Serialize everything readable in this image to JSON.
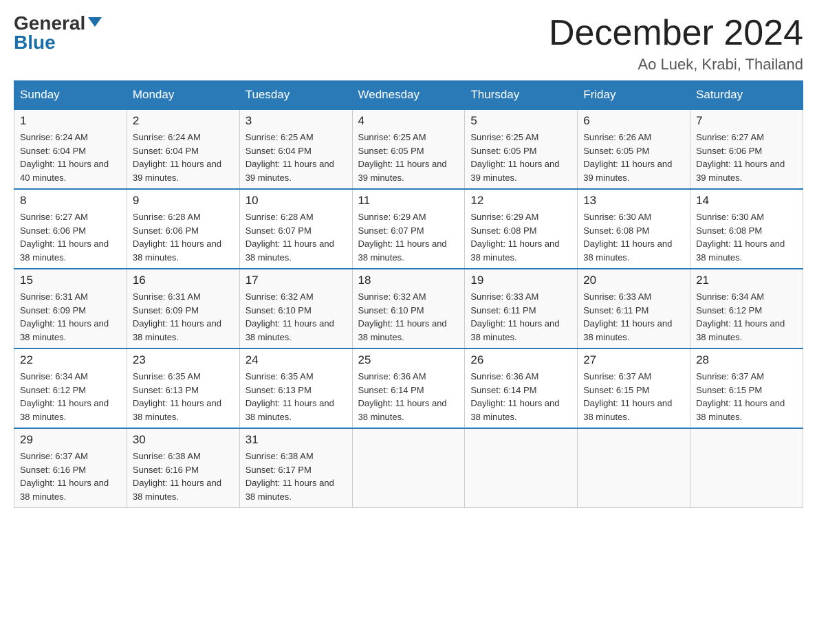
{
  "header": {
    "logo": {
      "general": "General",
      "blue": "Blue"
    },
    "title": "December 2024",
    "location": "Ao Luek, Krabi, Thailand"
  },
  "days_of_week": [
    "Sunday",
    "Monday",
    "Tuesday",
    "Wednesday",
    "Thursday",
    "Friday",
    "Saturday"
  ],
  "weeks": [
    [
      {
        "day": "1",
        "sunrise": "6:24 AM",
        "sunset": "6:04 PM",
        "daylight": "11 hours and 40 minutes."
      },
      {
        "day": "2",
        "sunrise": "6:24 AM",
        "sunset": "6:04 PM",
        "daylight": "11 hours and 39 minutes."
      },
      {
        "day": "3",
        "sunrise": "6:25 AM",
        "sunset": "6:04 PM",
        "daylight": "11 hours and 39 minutes."
      },
      {
        "day": "4",
        "sunrise": "6:25 AM",
        "sunset": "6:05 PM",
        "daylight": "11 hours and 39 minutes."
      },
      {
        "day": "5",
        "sunrise": "6:25 AM",
        "sunset": "6:05 PM",
        "daylight": "11 hours and 39 minutes."
      },
      {
        "day": "6",
        "sunrise": "6:26 AM",
        "sunset": "6:05 PM",
        "daylight": "11 hours and 39 minutes."
      },
      {
        "day": "7",
        "sunrise": "6:27 AM",
        "sunset": "6:06 PM",
        "daylight": "11 hours and 39 minutes."
      }
    ],
    [
      {
        "day": "8",
        "sunrise": "6:27 AM",
        "sunset": "6:06 PM",
        "daylight": "11 hours and 38 minutes."
      },
      {
        "day": "9",
        "sunrise": "6:28 AM",
        "sunset": "6:06 PM",
        "daylight": "11 hours and 38 minutes."
      },
      {
        "day": "10",
        "sunrise": "6:28 AM",
        "sunset": "6:07 PM",
        "daylight": "11 hours and 38 minutes."
      },
      {
        "day": "11",
        "sunrise": "6:29 AM",
        "sunset": "6:07 PM",
        "daylight": "11 hours and 38 minutes."
      },
      {
        "day": "12",
        "sunrise": "6:29 AM",
        "sunset": "6:08 PM",
        "daylight": "11 hours and 38 minutes."
      },
      {
        "day": "13",
        "sunrise": "6:30 AM",
        "sunset": "6:08 PM",
        "daylight": "11 hours and 38 minutes."
      },
      {
        "day": "14",
        "sunrise": "6:30 AM",
        "sunset": "6:08 PM",
        "daylight": "11 hours and 38 minutes."
      }
    ],
    [
      {
        "day": "15",
        "sunrise": "6:31 AM",
        "sunset": "6:09 PM",
        "daylight": "11 hours and 38 minutes."
      },
      {
        "day": "16",
        "sunrise": "6:31 AM",
        "sunset": "6:09 PM",
        "daylight": "11 hours and 38 minutes."
      },
      {
        "day": "17",
        "sunrise": "6:32 AM",
        "sunset": "6:10 PM",
        "daylight": "11 hours and 38 minutes."
      },
      {
        "day": "18",
        "sunrise": "6:32 AM",
        "sunset": "6:10 PM",
        "daylight": "11 hours and 38 minutes."
      },
      {
        "day": "19",
        "sunrise": "6:33 AM",
        "sunset": "6:11 PM",
        "daylight": "11 hours and 38 minutes."
      },
      {
        "day": "20",
        "sunrise": "6:33 AM",
        "sunset": "6:11 PM",
        "daylight": "11 hours and 38 minutes."
      },
      {
        "day": "21",
        "sunrise": "6:34 AM",
        "sunset": "6:12 PM",
        "daylight": "11 hours and 38 minutes."
      }
    ],
    [
      {
        "day": "22",
        "sunrise": "6:34 AM",
        "sunset": "6:12 PM",
        "daylight": "11 hours and 38 minutes."
      },
      {
        "day": "23",
        "sunrise": "6:35 AM",
        "sunset": "6:13 PM",
        "daylight": "11 hours and 38 minutes."
      },
      {
        "day": "24",
        "sunrise": "6:35 AM",
        "sunset": "6:13 PM",
        "daylight": "11 hours and 38 minutes."
      },
      {
        "day": "25",
        "sunrise": "6:36 AM",
        "sunset": "6:14 PM",
        "daylight": "11 hours and 38 minutes."
      },
      {
        "day": "26",
        "sunrise": "6:36 AM",
        "sunset": "6:14 PM",
        "daylight": "11 hours and 38 minutes."
      },
      {
        "day": "27",
        "sunrise": "6:37 AM",
        "sunset": "6:15 PM",
        "daylight": "11 hours and 38 minutes."
      },
      {
        "day": "28",
        "sunrise": "6:37 AM",
        "sunset": "6:15 PM",
        "daylight": "11 hours and 38 minutes."
      }
    ],
    [
      {
        "day": "29",
        "sunrise": "6:37 AM",
        "sunset": "6:16 PM",
        "daylight": "11 hours and 38 minutes."
      },
      {
        "day": "30",
        "sunrise": "6:38 AM",
        "sunset": "6:16 PM",
        "daylight": "11 hours and 38 minutes."
      },
      {
        "day": "31",
        "sunrise": "6:38 AM",
        "sunset": "6:17 PM",
        "daylight": "11 hours and 38 minutes."
      },
      null,
      null,
      null,
      null
    ]
  ],
  "labels": {
    "sunrise": "Sunrise:",
    "sunset": "Sunset:",
    "daylight": "Daylight:"
  }
}
